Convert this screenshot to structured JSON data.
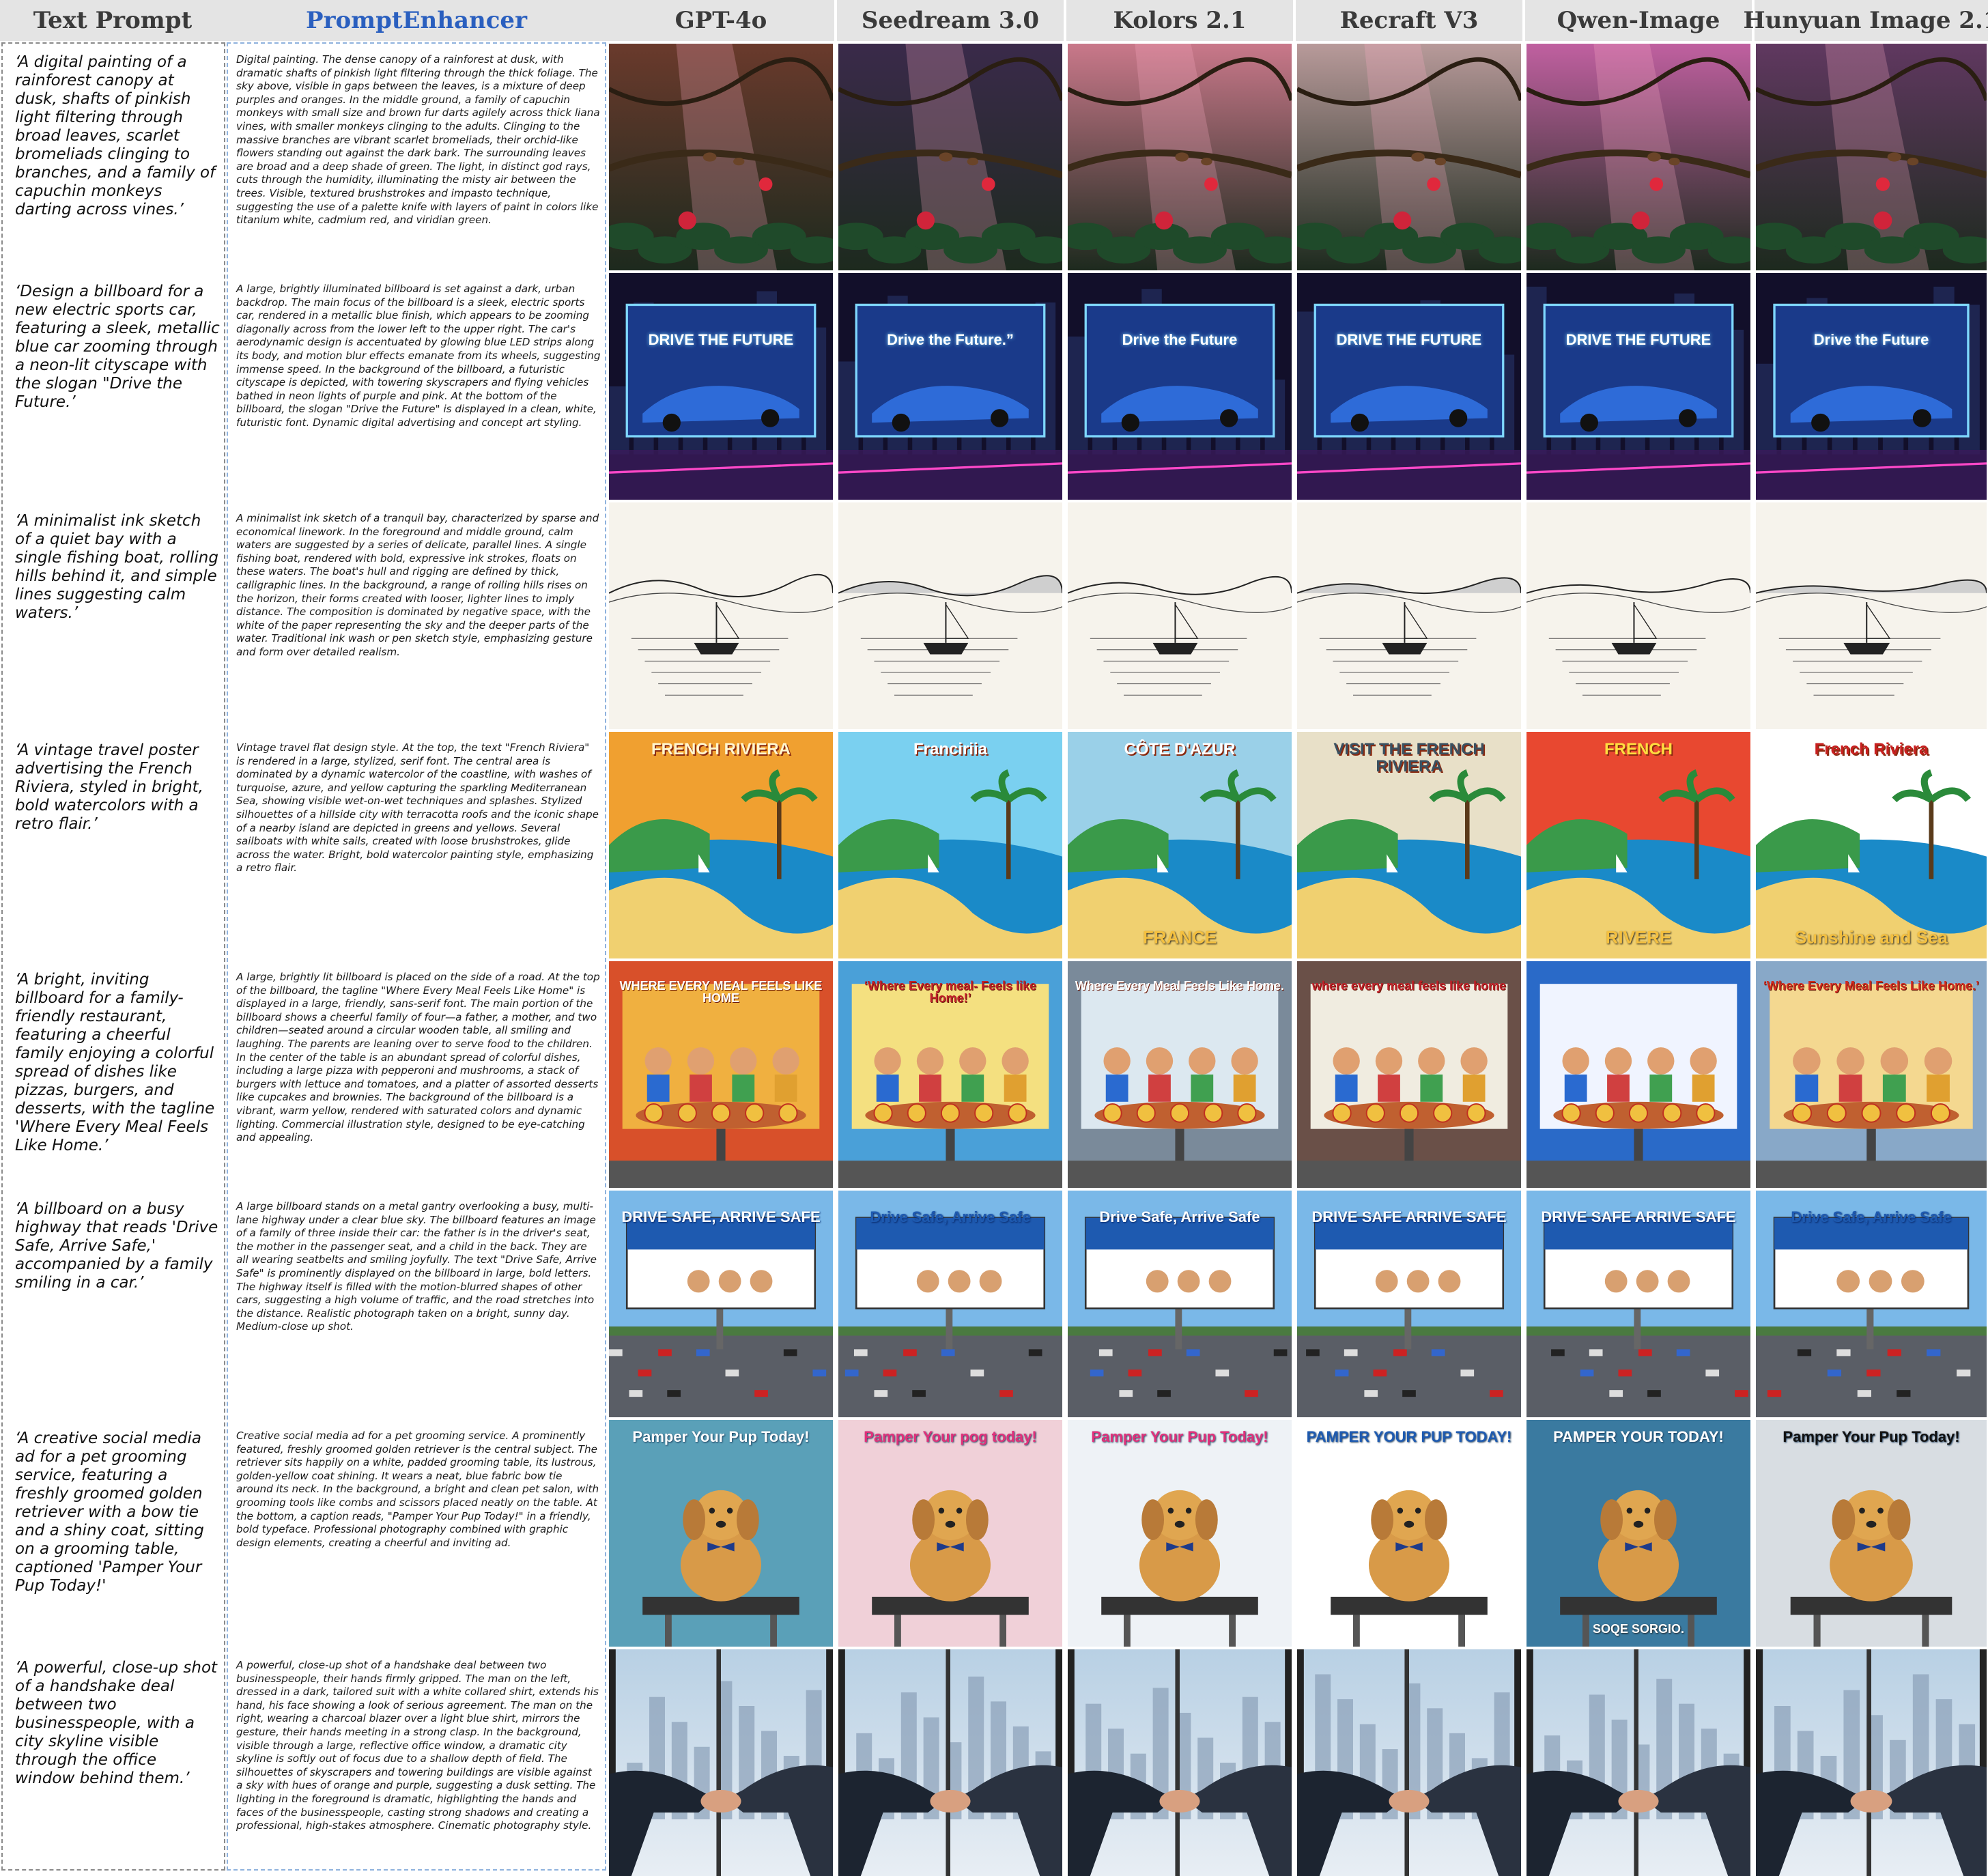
{
  "headers": [
    "Text Prompt",
    "PromptEnhancer",
    "GPT-4o",
    "Seedream 3.0",
    "Kolors 2.1",
    "Recraft V3",
    "Qwen-Image",
    "Hunyuan Image 2.1"
  ],
  "rows": [
    {
      "prompt": "‘A digital painting of a rainforest canopy at dusk, shafts of pinkish light filtering through broad leaves, scarlet bromeliads clinging to branches, and a family of capuchin monkeys darting across vines.’",
      "enhanced": "Digital painting. The dense canopy of a rainforest at dusk, with dramatic shafts of pinkish light filtering through the thick foliage. The sky above, visible in gaps between the leaves, is a mixture of deep purples and oranges. In the middle ground, a family of capuchin monkeys with small size and brown fur darts agilely across thick liana vines, with smaller monkeys clinging to the adults. Clinging to the massive branches are vibrant scarlet bromeliads, their orchid-like flowers standing out against the dark bark. The surrounding leaves are broad and a deep shade of green. The light, in distinct god rays, cuts through the humidity, illuminating the misty air between the trees. Visible, textured brushstrokes and impasto technique, suggesting the use of a palette knife with layers of paint in colors like titanium white, cadmium red, and viridian green.",
      "theme": "jungle",
      "captions": []
    },
    {
      "prompt": "‘Design a billboard for a new electric sports car, featuring a sleek, metallic blue car zooming through a neon-lit cityscape with the slogan \"Drive the Future.’",
      "enhanced": "A large, brightly illuminated billboard is set against a dark, urban backdrop. The main focus of the billboard is a sleek, electric sports car, rendered in a metallic blue finish, which appears to be zooming diagonally across from the lower left to the upper right. The car's aerodynamic design is accentuated by glowing blue LED strips along its body, and motion blur effects emanate from its wheels, suggesting immense speed. In the background of the billboard, a futuristic cityscape is depicted, with towering skyscrapers and flying vehicles bathed in neon lights of purple and pink. At the bottom of the billboard, the slogan \"Drive the Future\" is displayed in a clean, white, futuristic font. Dynamic digital advertising and concept art styling.",
      "theme": "neon",
      "captions": [
        "DRIVE THE FUTURE",
        "Drive the Future.”",
        "Drive the Future",
        "DRIVE THE FUTURE",
        "DRIVE THE FUTURE",
        "Drive the Future"
      ]
    },
    {
      "prompt": "‘A minimalist ink sketch of a quiet bay with a single fishing boat, rolling hills behind it, and simple lines suggesting calm waters.’",
      "enhanced": "A minimalist ink sketch of a tranquil bay, characterized by sparse and economical linework. In the foreground and middle ground, calm waters are suggested by a series of delicate, parallel lines. A single fishing boat, rendered with bold, expressive ink strokes, floats on these waters. The boat's hull and rigging are defined by thick, calligraphic lines. In the background, a range of rolling hills rises on the horizon, their forms created with looser, lighter lines to imply distance. The composition is dominated by negative space, with the white of the paper representing the sky and the deeper parts of the water. Traditional ink wash or pen sketch style, emphasizing gesture and form over detailed realism.",
      "theme": "ink",
      "captions": []
    },
    {
      "prompt": "‘A vintage travel poster advertising the French Riviera, styled in bright, bold watercolors with a retro flair.’",
      "enhanced": "Vintage travel flat design style. At the top, the text \"French Riviera\" is rendered in a large, stylized, serif font. The central area is dominated by a dynamic watercolor of the coastline, with washes of turquoise, azure, and yellow capturing the sparkling Mediterranean Sea, showing visible wet-on-wet techniques and splashes. Stylized silhouettes of a hillside city with terracotta roofs and the iconic shape of a nearby island are depicted in greens and yellows. Several sailboats with white sails, created with loose brushstrokes, glide across the water. Bright, bold watercolor painting style, emphasizing a retro flair.",
      "theme": "poster",
      "captions": [
        "FRENCH RIVIERA",
        "Franciriia",
        "CÔTE D'AZUR",
        "VISIT THE FRENCH RIVIERA",
        "FRENCH",
        "French Riviera"
      ],
      "captions2": [
        "",
        "",
        "FRANCE",
        "",
        "RIVERE",
        "Sunshine and Sea"
      ]
    },
    {
      "prompt": "‘A bright, inviting billboard for a family-friendly restaurant, featuring a cheerful family enjoying a colorful spread of dishes like pizzas, burgers, and desserts, with the tagline 'Where Every Meal Feels Like Home.’",
      "enhanced": "A large, brightly lit billboard is placed on the side of a road. At the top of the billboard, the tagline \"Where Every Meal Feels Like Home\" is displayed in a large, friendly, sans-serif font. The main portion of the billboard shows a cheerful family of four—a father, a mother, and two children—seated around a circular wooden table, all smiling and laughing. The parents are leaning over to serve food to the children. In the center of the table is an abundant spread of colorful dishes, including a large pizza with pepperoni and mushrooms, a stack of burgers with lettuce and tomatoes, and a platter of assorted desserts like cupcakes and brownies. The background of the billboard is a vibrant, warm yellow, rendered with saturated colors and dynamic lighting. Commercial illustration style, designed to be eye-catching and appealing.",
      "theme": "meal",
      "captions": [
        "WHERE EVERY MEAL FEELS LIKE HOME",
        "‘Where Every meal- Feels like Home!’",
        "Where Every Meal Feels Like Home.",
        "where every meal feels like home",
        "",
        "‘Where Every Meal Feels Like Home.’"
      ]
    },
    {
      "prompt": "‘A billboard on a busy highway that reads 'Drive Safe, Arrive Safe,' accompanied by a family smiling in a car.’",
      "enhanced": "A large billboard stands on a metal gantry overlooking a busy, multi-lane highway under a clear blue sky. The billboard features an image of a family of three inside their car: the father is in the driver's seat, the mother in the passenger seat, and a child in the back. They are all wearing seatbelts and smiling joyfully. The text \"Drive Safe, Arrive Safe\" is prominently displayed on the billboard in large, bold letters. The highway itself is filled with the motion-blurred shapes of other cars, suggesting a high volume of traffic, and the road stretches into the distance. Realistic photograph taken on a bright, sunny day. Medium-close up shot.",
      "theme": "highway",
      "captions": [
        "DRIVE SAFE, ARRIVE SAFE",
        "Drive Safe, Arrive Safe",
        "Drive Safe, Arrive Safe",
        "DRIVE SAFE ARRIVE SAFE",
        "DRIVE SAFE ARRIVE SAFE",
        "Drive Safe, Arrive Safe"
      ]
    },
    {
      "prompt": "‘A creative social media ad for a pet grooming service, featuring a freshly groomed golden retriever with a bow tie and a shiny coat, sitting on a grooming table, captioned 'Pamper Your Pup Today!'",
      "enhanced": "Creative social media ad for a pet grooming service. A prominently featured, freshly groomed golden retriever is the central subject. The retriever sits happily on a white, padded grooming table, its lustrous, golden-yellow coat shining. It wears a neat, blue fabric bow tie around its neck. In the background, a bright and clean pet salon, with grooming tools like combs and scissors placed neatly on the table. At the bottom, a caption reads, \"Pamper Your Pup Today!\" in a friendly, bold typeface. Professional photography combined with graphic design elements, creating a cheerful and inviting ad.",
      "theme": "dog",
      "captions": [
        "Pamper Your Pup Today!",
        "Pamper Your pog today!",
        "Pamper Your Pup Today!",
        "PAMPER YOUR PUP TODAY!",
        "PAMPER YOUR TODAY!",
        "Pamper Your Pup Today!"
      ],
      "captions2": [
        "",
        "",
        "",
        "",
        "SOQE SORGIO.",
        ""
      ]
    },
    {
      "prompt": "‘A powerful, close-up shot of a handshake deal between two businesspeople, with a city skyline visible through the office window behind them.’",
      "enhanced": "A powerful, close-up shot of a handshake deal between two businesspeople, their hands firmly gripped. The man on the left, dressed in a dark, tailored suit with a white collared shirt, extends his hand, his face showing a look of serious agreement. The man on the right, wearing a charcoal blazer over a light blue shirt, mirrors the gesture, their hands meeting in a strong clasp. In the background, visible through a large, reflective office window, a dramatic city skyline is softly out of focus due to a shallow depth of field. The silhouettes of skyscrapers and towering buildings are visible against a sky with hues of orange and purple, suggesting a dusk setting. The lighting in the foreground is dramatic, highlighting the hands and faces of the businesspeople, casting strong shadows and creating a professional, high-stakes atmosphere. Cinematic photography style.",
      "theme": "hand",
      "captions": []
    }
  ]
}
